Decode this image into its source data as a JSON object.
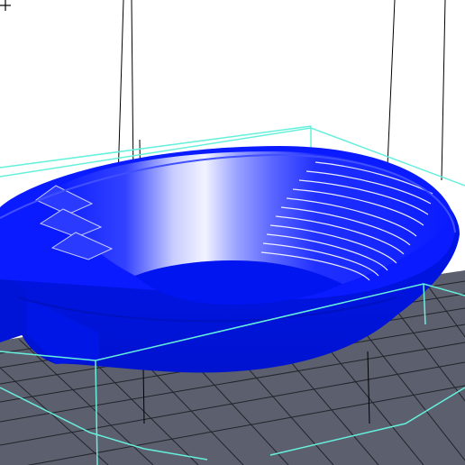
{
  "viewer": {
    "background_color": "#ffffff",
    "bed_color": "#5b5f6e",
    "bed_grid_color": "#1c1e22",
    "bounding_box_color": "#66f0dc",
    "frame_line_color": "#000000",
    "model_color": "#0019ff",
    "model_highlight_color": "#e8ecff",
    "center_marker_icon": "crosshair-icon"
  }
}
